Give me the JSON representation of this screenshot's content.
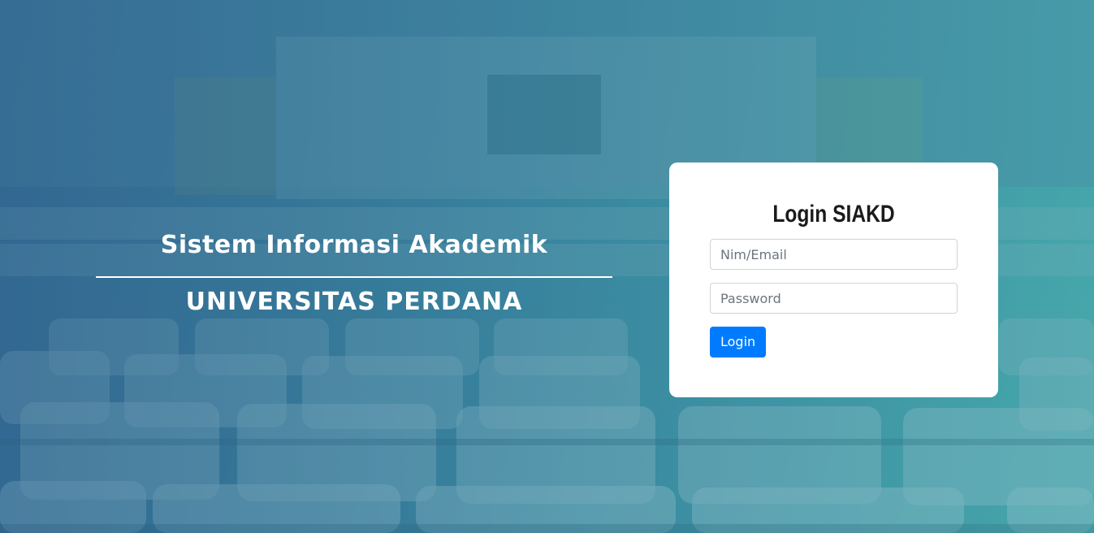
{
  "hero": {
    "title": "Sistem Informasi Akademik",
    "subtitle": "UNIVERSITAS PERDANA"
  },
  "login": {
    "title": "Login SIAKD",
    "username_placeholder": "Nim/Email",
    "username_value": "",
    "password_placeholder": "Password",
    "password_value": "",
    "button_label": "Login"
  },
  "colors": {
    "primary": "#007bff",
    "card_bg": "#ffffff",
    "overlay_blue": "#3a6f97",
    "overlay_teal": "#46a6ac"
  },
  "background": {
    "description_icon": "lecture-hall-seats-background"
  }
}
